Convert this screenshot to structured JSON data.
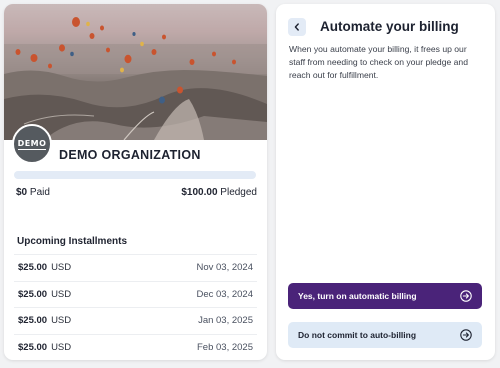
{
  "organization": {
    "avatar_text": "DEMO",
    "name": "DEMO ORGANIZATION"
  },
  "pledge": {
    "paid_amount": "$0",
    "paid_label": "Paid",
    "pledged_amount": "$100.00",
    "pledged_label": "Pledged",
    "progress_fraction": 0
  },
  "installments": {
    "title": "Upcoming Installments",
    "rows": [
      {
        "amount": "$25.00",
        "currency": "USD",
        "date": "Nov 03, 2024"
      },
      {
        "amount": "$25.00",
        "currency": "USD",
        "date": "Dec 03, 2024"
      },
      {
        "amount": "$25.00",
        "currency": "USD",
        "date": "Jan 03, 2025"
      },
      {
        "amount": "$25.00",
        "currency": "USD",
        "date": "Feb 03, 2025"
      }
    ]
  },
  "panel": {
    "title": "Automate your billing",
    "description": "When you automate your billing, it frees up our staff from needing to check on your pledge and reach out for fulfillment.",
    "primary_button": "Yes, turn on automatic billing",
    "secondary_button": "Do not commit to auto-billing"
  },
  "icons": {
    "back": "chevron-left-icon",
    "primary_arrow": "arrow-right-circle-icon",
    "secondary_arrow": "arrow-right-circle-icon"
  },
  "colors": {
    "primary": "#4a2379",
    "secondary_button_bg": "#dfeaf6",
    "progress_track": "#e3ebf6",
    "page_bg": "#f1f2f4"
  }
}
